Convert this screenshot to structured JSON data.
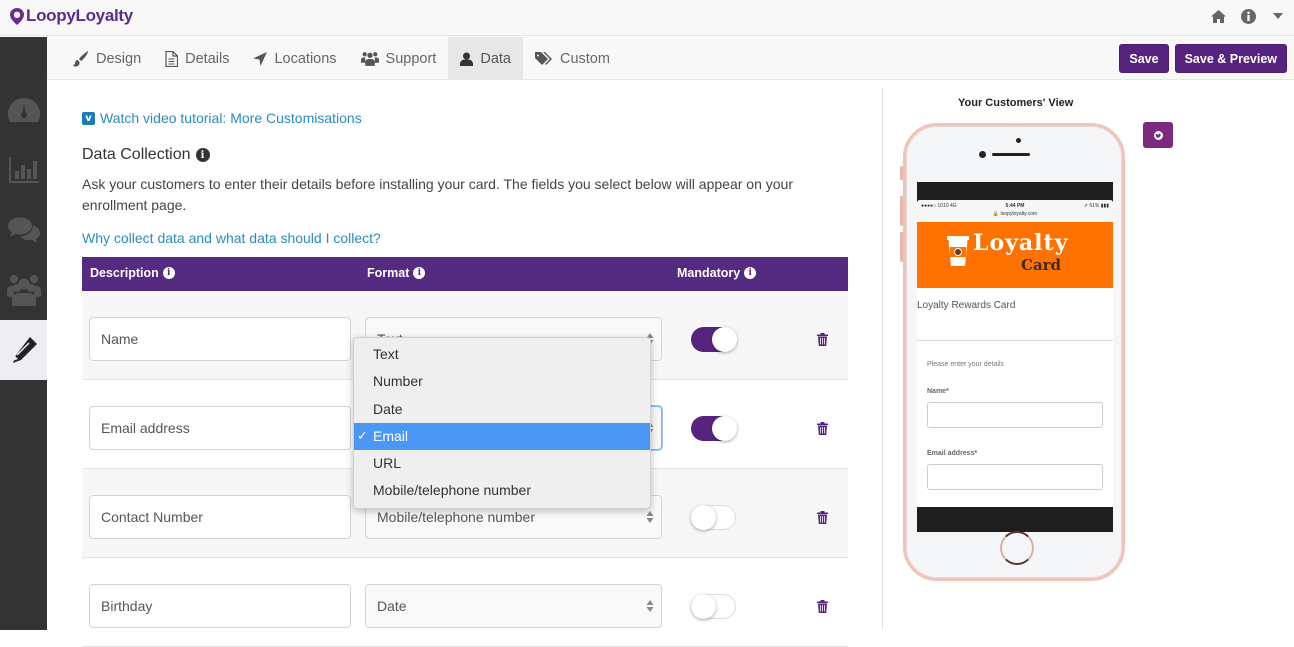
{
  "app": {
    "title": "LoopyLoyalty"
  },
  "topbar": {
    "icons": [
      "home-icon",
      "info-icon",
      "caret-down-icon"
    ]
  },
  "sidebar": {
    "items": [
      {
        "icon": "dashboard-icon",
        "active": false
      },
      {
        "icon": "bar-chart-icon",
        "active": false
      },
      {
        "icon": "comments-icon",
        "active": false
      },
      {
        "icon": "users-icon",
        "active": false
      },
      {
        "icon": "pencil-icon",
        "active": true
      }
    ]
  },
  "tabs": [
    {
      "label": "Design",
      "icon": "paint-brush-icon",
      "active": false
    },
    {
      "label": "Details",
      "icon": "document-icon",
      "active": false
    },
    {
      "label": "Locations",
      "icon": "location-arrow-icon",
      "active": false
    },
    {
      "label": "Support",
      "icon": "users-icon",
      "active": false
    },
    {
      "label": "Data",
      "icon": "user-icon",
      "active": true
    },
    {
      "label": "Custom",
      "icon": "tags-icon",
      "active": false
    }
  ],
  "toolbar": {
    "save_label": "Save",
    "save_preview_label": "Save & Preview"
  },
  "main": {
    "video_link": "Watch video tutorial: More Customisations",
    "section_title": "Data Collection",
    "description": "Ask your customers to enter their details before installing your card. The fields you select below will appear on your enrollment page.",
    "why_link": "Why collect data and what data should I collect?"
  },
  "table": {
    "headers": {
      "description": "Description",
      "format": "Format",
      "mandatory": "Mandatory"
    },
    "rows": [
      {
        "description": "Name",
        "format": "Text",
        "mandatory": true
      },
      {
        "description": "Email address",
        "format": "Email",
        "mandatory": true
      },
      {
        "description": "Contact Number",
        "format": "Mobile/telephone number",
        "mandatory": false
      },
      {
        "description": "Birthday",
        "format": "Date",
        "mandatory": false
      }
    ]
  },
  "dropdown": {
    "open_for_row": 1,
    "options": [
      "Text",
      "Number",
      "Date",
      "Email",
      "URL",
      "Mobile/telephone number"
    ],
    "selected": "Email",
    "check": "✓"
  },
  "preview": {
    "title": "Your Customers' View",
    "status_left": "●●●●○ 1010  4G",
    "status_time": "5:44 PM",
    "status_right": "➚ 61% ▮▮▮",
    "url": "🔒 loopyloyalty.com",
    "brand_line1": "Loyalty",
    "brand_line2": "Card",
    "card_name": "Loyalty Rewards Card",
    "form_hint": "Please enter your details",
    "field1_label": "Name*",
    "field2_label": "Email address*"
  },
  "colors": {
    "brand_purple": "#56247f",
    "header_purple": "#552b81",
    "link_blue": "#2a8bbf",
    "banner_orange": "#ff7200",
    "selected_blue": "#4a97f5"
  }
}
